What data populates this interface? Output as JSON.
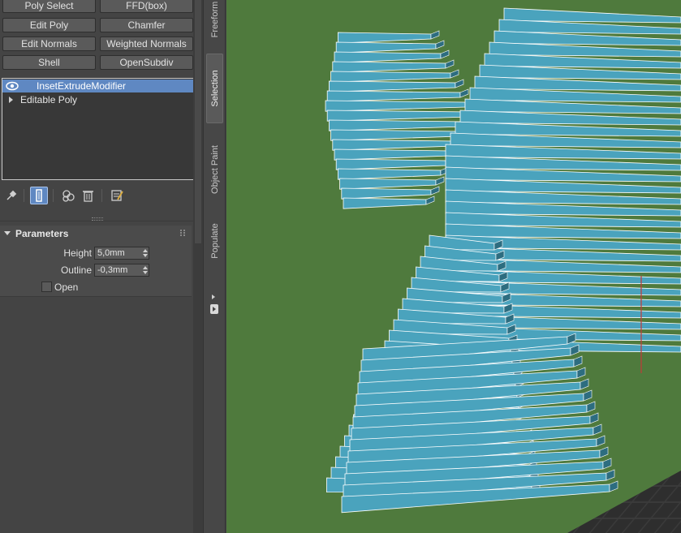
{
  "modifier_buttons": [
    {
      "label": "Poly Select"
    },
    {
      "label": "FFD(box)"
    },
    {
      "label": "Edit Poly"
    },
    {
      "label": "Chamfer"
    },
    {
      "label": "Edit Normals"
    },
    {
      "label": "Weighted Normals"
    },
    {
      "label": "Shell"
    },
    {
      "label": "OpenSubdiv"
    }
  ],
  "stack": {
    "items": [
      {
        "label": "InsetExtrudeModifier",
        "selected": true
      },
      {
        "label": "Editable Poly",
        "selected": false
      }
    ]
  },
  "stack_tools": {
    "icons": [
      "pin-stack-icon",
      "show-end-result-icon",
      "make-unique-icon",
      "remove-modifier-icon",
      "configure-modifier-sets-icon"
    ]
  },
  "parameters": {
    "title": "Parameters",
    "height_label": "Height",
    "height_value": "5,0mm",
    "outline_label": "Outline",
    "outline_value": "-0,3mm",
    "open_label": "Open",
    "open_checked": false
  },
  "tabs": {
    "freeform": "Freeform",
    "selection": "Selection",
    "object_paint": "Object Paint",
    "populate": "Populate"
  },
  "colors": {
    "accent": "#5f88c2",
    "viewport_bg": "#4f7a3d",
    "object_face": "#4aa3bd",
    "object_dark": "#2d6d80"
  }
}
